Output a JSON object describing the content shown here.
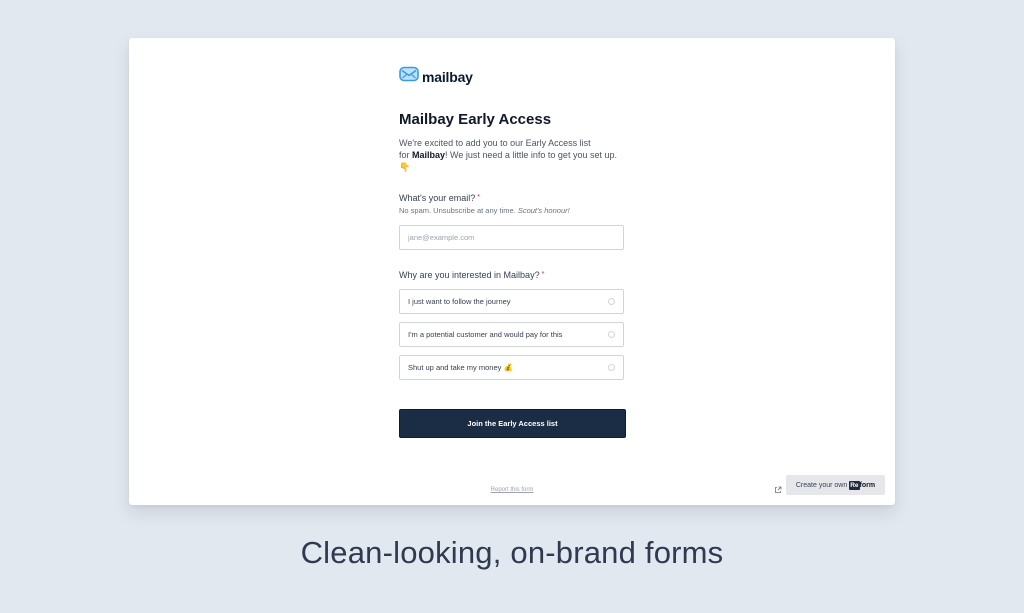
{
  "form": {
    "brand": "mailbay",
    "title": "Mailbay Early Access",
    "intro_line1": "We're excited to add you to our Early Access list",
    "intro_for": "for ",
    "intro_brand": "Mailbay",
    "intro_rest": "! We just need a little info to get you set up.",
    "intro_emoji": "👇",
    "email_question": "What's your email?",
    "required_mark": "*",
    "email_help": "No spam. Unsubscribe at any time.",
    "email_help_italic": "Scout's honour!",
    "email_placeholder": "jane@example.com",
    "email_value": "",
    "interest_question": "Why are you interested in Mailbay?",
    "options": [
      {
        "label": "I just want to follow the journey"
      },
      {
        "label": "I'm a potential customer and would pay for this"
      },
      {
        "label": "Shut up and take my money 💰"
      }
    ],
    "submit_label": "Join the Early Access list",
    "report_link": "Report this form",
    "create_own_prefix": "Create your own",
    "create_own_brand_mark": "Re",
    "create_own_brand_rest": "form"
  },
  "tagline": "Clean-looking, on-brand forms",
  "icons": {
    "logo": "mailbay-envelope-logo-icon",
    "external_link": "external-link-icon"
  },
  "colors": {
    "page_background": "#e2e8f0",
    "card_background": "#ffffff",
    "submit_button": "#1b2d45",
    "required_marker": "#dc2626",
    "logo_blue": "#3b9ae8"
  }
}
